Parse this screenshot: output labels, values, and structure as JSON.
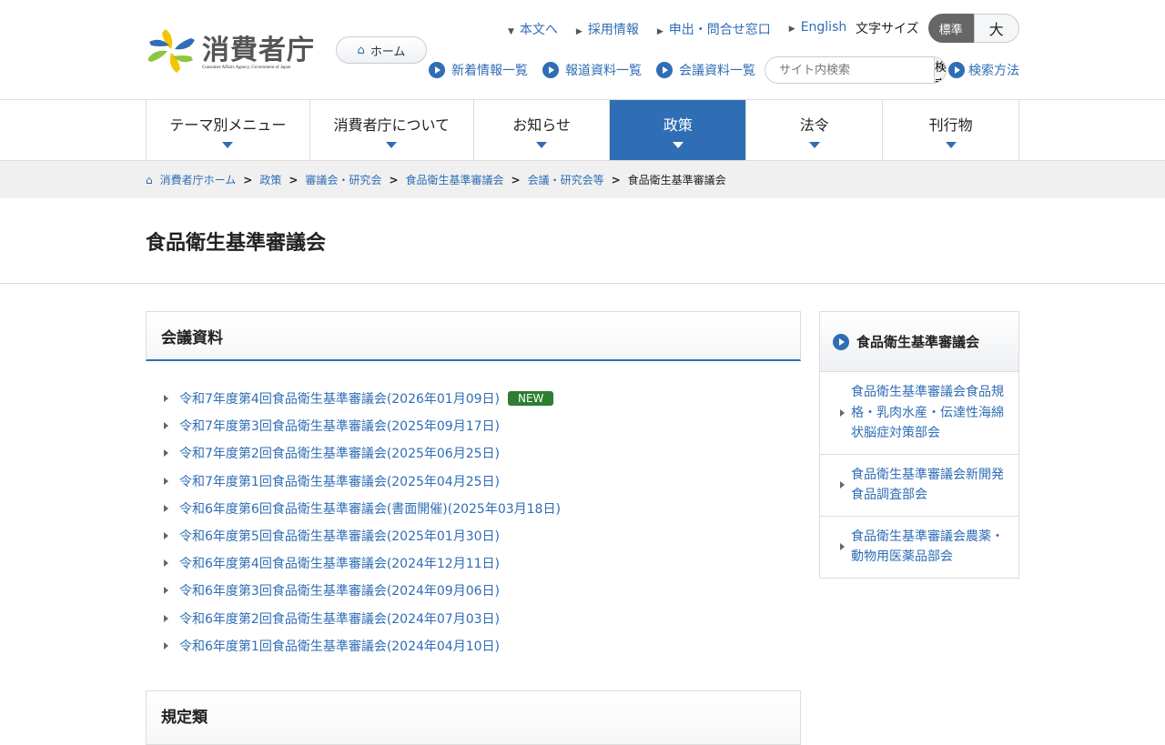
{
  "header": {
    "logo_text": "消費者庁",
    "logo_sub": "Consumer Affairs Agency, Government of Japan",
    "home_label": "ホーム",
    "top_links": [
      "本文へ",
      "採用情報",
      "申出・問合せ窓口",
      "English"
    ],
    "font_size_label": "文字サイズ",
    "font_size_standard": "標準",
    "font_size_large": "大",
    "sub_links": [
      "新着情報一覧",
      "報道資料一覧",
      "会議資料一覧"
    ],
    "search_placeholder": "サイト内検索",
    "search_button": "検索",
    "search_howto": "検索方法"
  },
  "nav": {
    "items": [
      "テーマ別メニュー",
      "消費者庁について",
      "お知らせ",
      "政策",
      "法令",
      "刊行物"
    ],
    "active": 3
  },
  "breadcrumb": [
    "消費者庁ホーム",
    "政策",
    "審議会・研究会",
    "食品衛生基準審議会",
    "会議・研究会等"
  ],
  "breadcrumb_current": "食品衛生基準審議会",
  "page_title": "食品衛生基準審議会",
  "main": {
    "section_title": "会議資料",
    "new_badge": "NEW",
    "items": [
      "令和7年度第4回食品衛生基準審議会(2026年01月09日)",
      "令和7年度第3回食品衛生基準審議会(2025年09月17日)",
      "令和7年度第2回食品衛生基準審議会(2025年06月25日)",
      "令和7年度第1回食品衛生基準審議会(2025年04月25日)",
      "令和6年度第6回食品衛生基準審議会(書面開催)(2025年03月18日)",
      "令和6年度第5回食品衛生基準審議会(2025年01月30日)",
      "令和6年度第4回食品衛生基準審議会(2024年12月11日)",
      "令和6年度第3回食品衛生基準審議会(2024年09月06日)",
      "令和6年度第2回食品衛生基準審議会(2024年07月03日)",
      "令和6年度第1回食品衛生基準審議会(2024年04月10日)"
    ],
    "section2_title": "規定類"
  },
  "sidebar": {
    "title": "食品衛生基準審議会",
    "items": [
      "食品衛生基準審議会食品規格・乳肉水産・伝達性海綿状脳症対策部会",
      "食品衛生基準審議会新開発食品調査部会",
      "食品衛生基準審議会農薬・動物用医薬品部会"
    ]
  }
}
